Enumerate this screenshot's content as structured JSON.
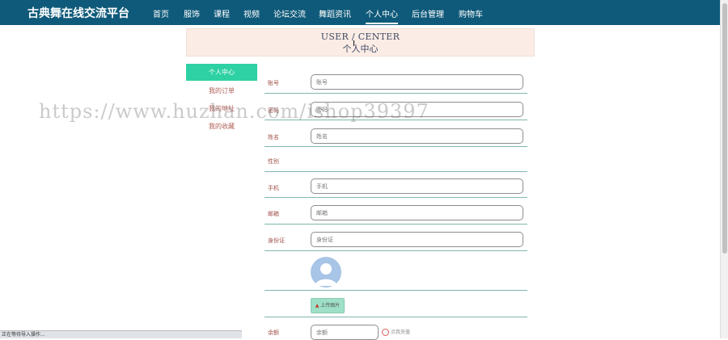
{
  "header": {
    "brand": "古典舞在线交流平台",
    "nav": [
      "首页",
      "服饰",
      "课程",
      "视频",
      "论坛交流",
      "舞蹈资讯",
      "个人中心",
      "后台管理",
      "购物车"
    ],
    "active_nav": "个人中心",
    "bg_color": "#0f5a7a"
  },
  "banner": {
    "title_en": "USER / CENTER",
    "title_zh": "个人中心"
  },
  "sidebar": {
    "items": [
      {
        "label": "个人中心",
        "active": true
      },
      {
        "label": "我的订单"
      },
      {
        "label": "我的地址"
      },
      {
        "label": "我的收藏"
      }
    ],
    "active_color": "#2ed1a3"
  },
  "form": {
    "account": {
      "label": "账号",
      "placeholder": "账号"
    },
    "password": {
      "label": "密码",
      "placeholder": "密码"
    },
    "name": {
      "label": "姓名",
      "placeholder": "姓名"
    },
    "gender": {
      "label": "性别"
    },
    "phone": {
      "label": "手机",
      "placeholder": "手机"
    },
    "email": {
      "label": "邮箱",
      "placeholder": "邮箱"
    },
    "idcard": {
      "label": "身份证",
      "placeholder": "身份证"
    },
    "upload_label": "上传图片",
    "balance": {
      "label": "余额",
      "placeholder": "余额"
    },
    "recharge_label": "点我充值"
  },
  "watermark": "https://www.huzhan.com/ishop39397",
  "status_bar": "正在等待导入操作..."
}
